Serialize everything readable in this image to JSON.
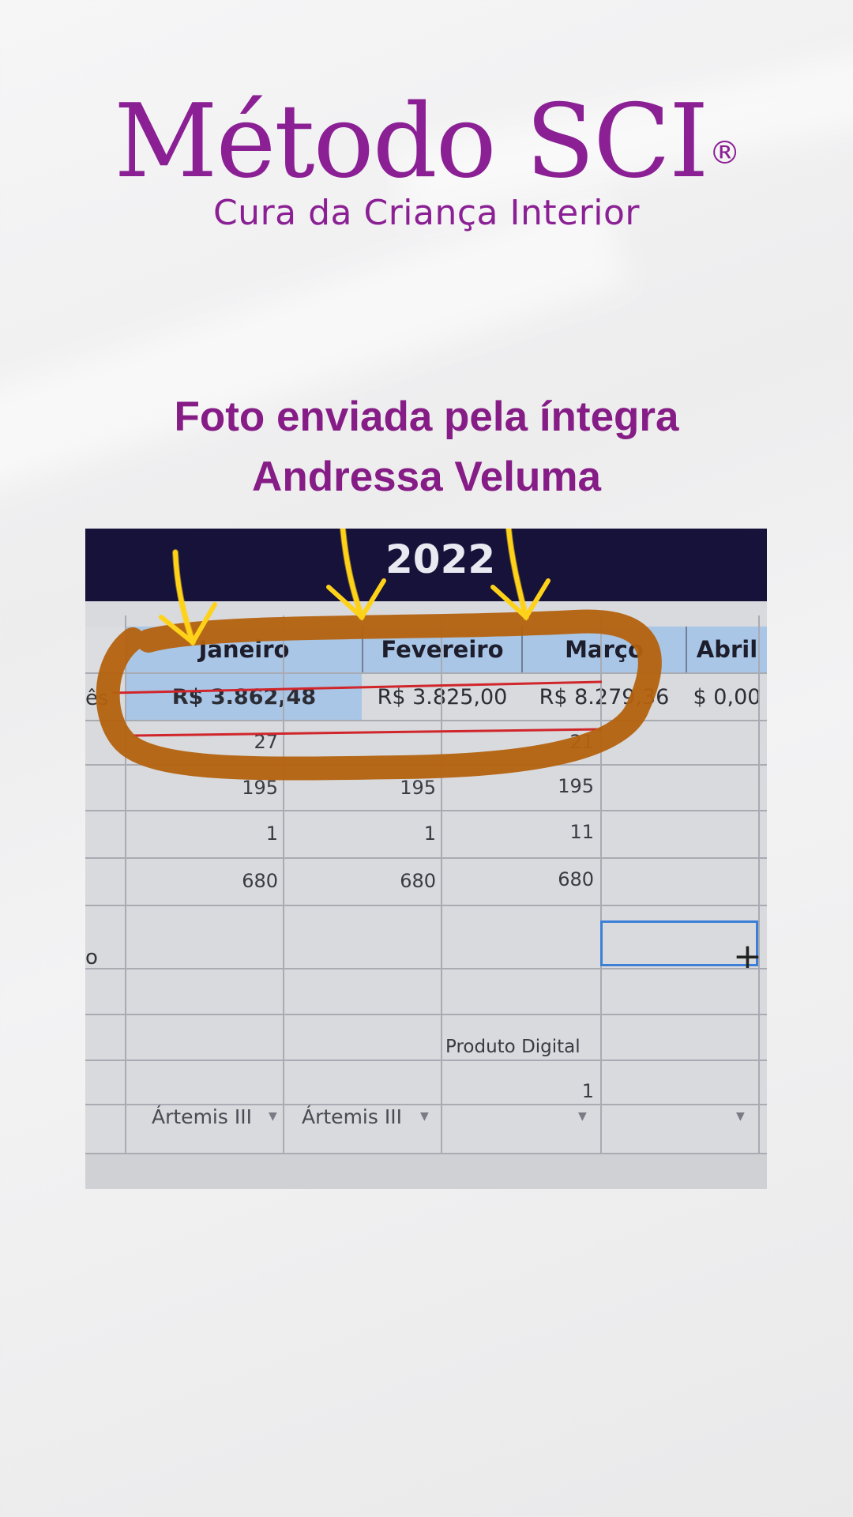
{
  "logo": {
    "title": "Método SCI",
    "registered": "®",
    "subtitle": "Cura da Criança Interior"
  },
  "caption": {
    "line1": "Foto enviada pela íntegra",
    "line2": "Andressa Veluma"
  },
  "photo": {
    "year": "2022",
    "months": [
      "Janeiro",
      "Fevereiro",
      "Março",
      "Abril"
    ],
    "values": [
      "R$ 3.862,48",
      "R$ 3.825,00",
      "R$ 8.279,36",
      "$ 0,00"
    ],
    "row_label_partial": "ês",
    "row_label_partial_2": "o",
    "partial_row": [
      "27",
      "21"
    ],
    "rows": [
      [
        "195",
        "195",
        "195"
      ],
      [
        "1",
        "1",
        "11"
      ],
      [
        "680",
        "680",
        "680"
      ]
    ],
    "product_label": "Produto Digital",
    "product_count": "1",
    "dropdowns": [
      "Ártemis III",
      "Ártemis III"
    ]
  },
  "colors": {
    "brand_purple": "#8b1f94",
    "highlight_orange": "#b4620e",
    "arrow_yellow": "#ffd21a",
    "header_blue": "#a9c6e6"
  }
}
